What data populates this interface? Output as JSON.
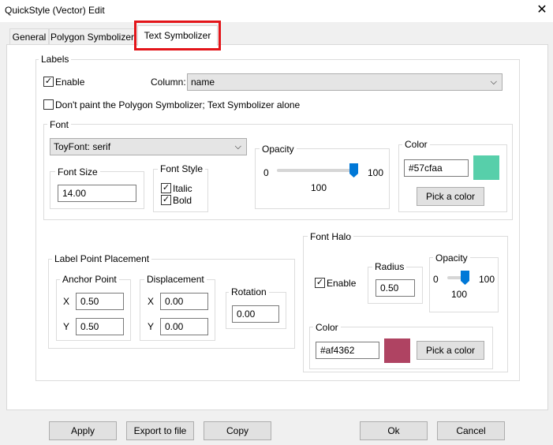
{
  "window": {
    "title": "QuickStyle (Vector) Edit",
    "close_glyph": "✕"
  },
  "tabs": [
    {
      "label": "General"
    },
    {
      "label": "Polygon Symbolizer"
    },
    {
      "label": "Text Symbolizer"
    }
  ],
  "labels_group": {
    "title": "Labels",
    "enable": {
      "label": "Enable",
      "checked": true
    },
    "column": {
      "label": "Column:",
      "value": "name"
    },
    "dont_paint": {
      "label": "Don't paint the Polygon Symbolizer; Text Symbolizer alone",
      "checked": false
    }
  },
  "font_group": {
    "title": "Font",
    "font_select": "ToyFont: serif",
    "size": {
      "title": "Font Size",
      "value": "14.00"
    },
    "style": {
      "title": "Font Style",
      "italic": "Italic",
      "bold": "Bold",
      "italic_checked": true,
      "bold_checked": true
    },
    "opacity": {
      "title": "Opacity",
      "min": "0",
      "max": "100",
      "value": "100",
      "level": 100
    },
    "color": {
      "title": "Color",
      "value": "#57cfaa",
      "swatch": "#57cfaa",
      "button": "Pick a color"
    }
  },
  "placement_group": {
    "title": "Label Point Placement",
    "anchor": {
      "title": "Anchor Point",
      "x_label": "X",
      "x": "0.50",
      "y_label": "Y",
      "y": "0.50"
    },
    "displacement": {
      "title": "Displacement",
      "x_label": "X",
      "x": "0.00",
      "y_label": "Y",
      "y": "0.00"
    },
    "rotation": {
      "title": "Rotation",
      "value": "0.00"
    }
  },
  "halo_group": {
    "title": "Font Halo",
    "enable": {
      "label": "Enable",
      "checked": true
    },
    "radius": {
      "title": "Radius",
      "value": "0.50"
    },
    "opacity": {
      "title": "Opacity",
      "min": "0",
      "max": "100",
      "value": "100",
      "level": 100
    },
    "color": {
      "title": "Color",
      "value": "#af4362",
      "swatch": "#af4362",
      "button": "Pick a color"
    }
  },
  "footer": {
    "apply": "Apply",
    "export": "Export to file",
    "copy": "Copy",
    "ok": "Ok",
    "cancel": "Cancel"
  },
  "colors": {
    "highlight": "#e3151a",
    "slider_thumb": "#0078d7"
  },
  "icons": {
    "dropdown": "chevron-down-icon",
    "check": "check-icon",
    "close": "close-icon"
  }
}
